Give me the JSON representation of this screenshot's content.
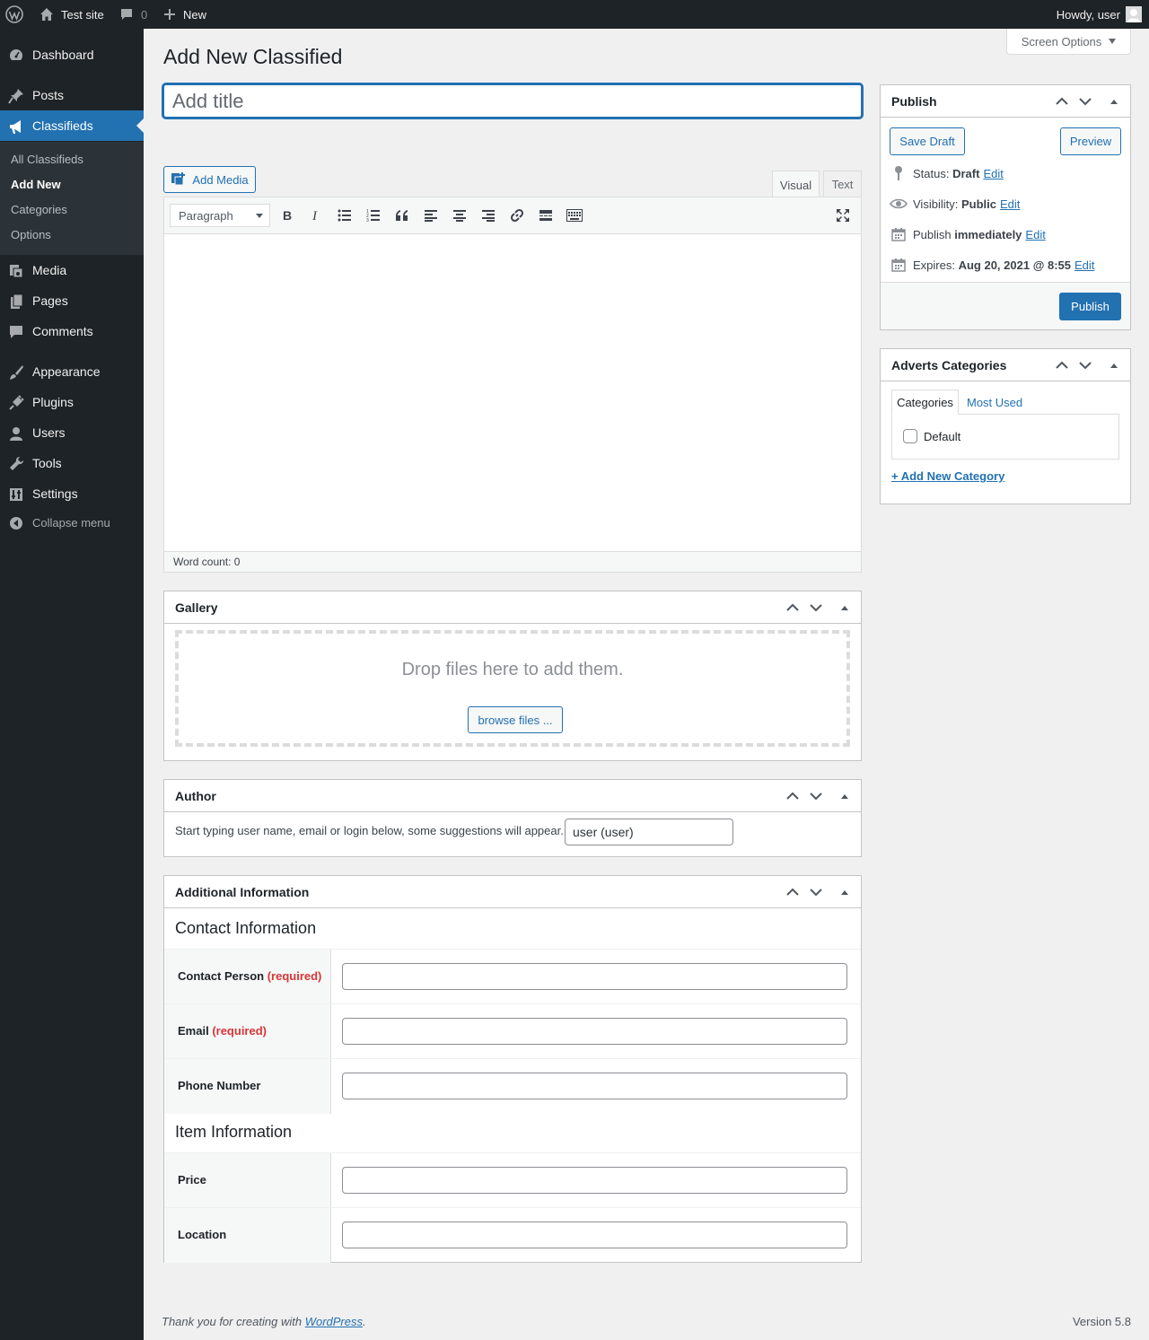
{
  "adminbar": {
    "site_name": "Test site",
    "comment_count": "0",
    "new_label": "New",
    "howdy": "Howdy, user"
  },
  "sidebar": {
    "items": [
      {
        "label": "Dashboard",
        "icon": "dashboard-icon"
      },
      {
        "label": "Posts",
        "icon": "pin-icon"
      },
      {
        "label": "Classifieds",
        "icon": "megaphone-icon"
      },
      {
        "label": "Media",
        "icon": "media-icon"
      },
      {
        "label": "Pages",
        "icon": "pages-icon"
      },
      {
        "label": "Comments",
        "icon": "comment-icon"
      },
      {
        "label": "Appearance",
        "icon": "brush-icon"
      },
      {
        "label": "Plugins",
        "icon": "plugin-icon"
      },
      {
        "label": "Users",
        "icon": "user-icon"
      },
      {
        "label": "Tools",
        "icon": "wrench-icon"
      },
      {
        "label": "Settings",
        "icon": "sliders-icon"
      }
    ],
    "submenu": [
      "All Classifieds",
      "Add New",
      "Categories",
      "Options"
    ],
    "collapse_label": "Collapse menu"
  },
  "screen_options": "Screen Options",
  "page_title": "Add New Classified",
  "title_placeholder": "Add title",
  "editor": {
    "add_media": "Add Media",
    "tab_visual": "Visual",
    "tab_text": "Text",
    "format": "Paragraph",
    "word_count": "Word count: 0"
  },
  "gallery": {
    "title": "Gallery",
    "drop_text": "Drop files here to add them.",
    "browse": "browse files ..."
  },
  "author": {
    "title": "Author",
    "hint": "Start typing user name, email or login below, some suggestions will appear.",
    "value": "user (user)"
  },
  "additional": {
    "title": "Additional Information",
    "contact_heading": "Contact Information",
    "item_heading": "Item Information",
    "required_label": "(required)",
    "fields": {
      "contact_person": "Contact Person",
      "email": "Email",
      "phone": "Phone Number",
      "price": "Price",
      "location": "Location"
    }
  },
  "publish": {
    "title": "Publish",
    "save_draft": "Save Draft",
    "preview": "Preview",
    "status_label": "Status:",
    "status_value": "Draft",
    "visibility_label": "Visibility:",
    "visibility_value": "Public",
    "publish_label": "Publish",
    "publish_value": "immediately",
    "expires_label": "Expires:",
    "expires_value": "Aug 20, 2021 @ 8:55",
    "edit": "Edit",
    "publish_button": "Publish"
  },
  "categories": {
    "title": "Adverts Categories",
    "tab_all": "Categories",
    "tab_most_used": "Most Used",
    "default_label": "Default",
    "add_new": "+ Add New Category"
  },
  "footer": {
    "thanks_prefix": "Thank you for creating with ",
    "wp_link": "WordPress",
    "thanks_suffix": ".",
    "version": "Version 5.8"
  },
  "colors": {
    "admin_dark": "#1d2327",
    "accent": "#2271b1",
    "required": "#d63638",
    "page_bg": "#f0f0f1"
  }
}
